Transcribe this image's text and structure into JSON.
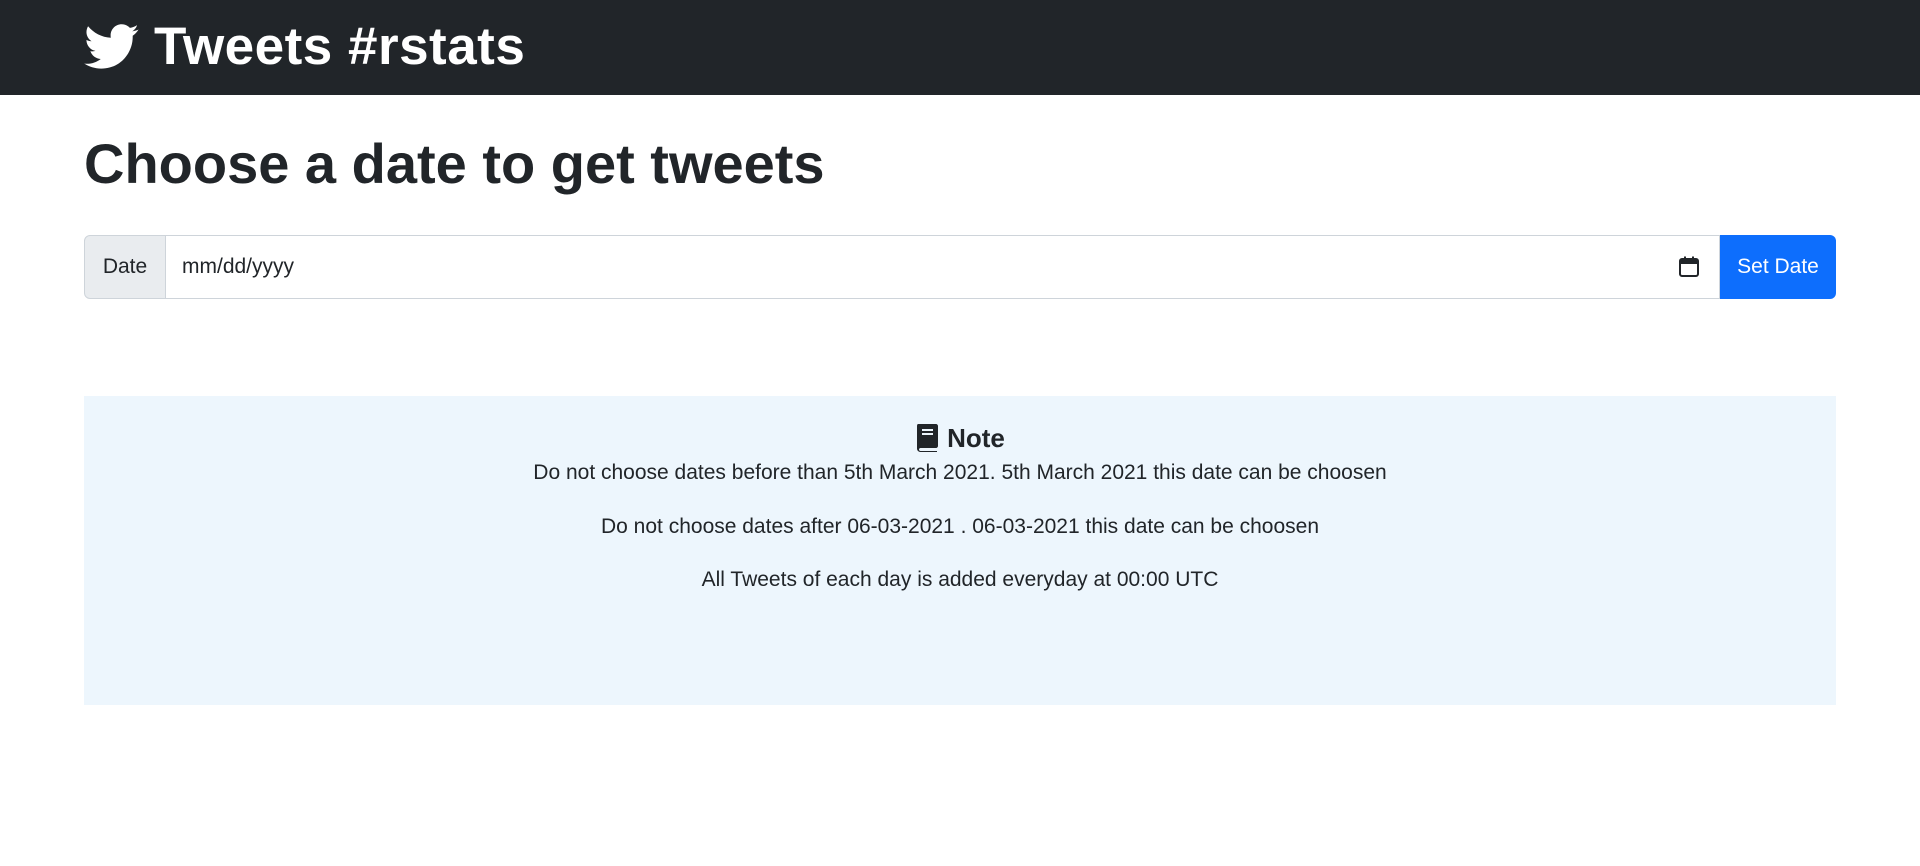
{
  "navbar": {
    "brand_title": "Tweets #rstats",
    "brand_icon": "twitter-bird-icon"
  },
  "page": {
    "title": "Choose a date to get tweets"
  },
  "date_form": {
    "label": "Date",
    "date_input_value": "mm/dd/yyyy",
    "calendar_icon": "calendar-icon",
    "button_label": "Set Date"
  },
  "note": {
    "icon": "book-icon",
    "heading": "Note",
    "lines": [
      "Do not choose dates before than 5th March 2021. 5th March 2021 this date can be choosen",
      "Do not choose dates after 06-03-2021 . 06-03-2021 this date can be choosen",
      "All Tweets of each day is added everyday at 00:00 UTC"
    ]
  },
  "colors": {
    "navbar_bg": "#212529",
    "primary": "#0d6efd",
    "note_bg": "#edf6fd",
    "addon_bg": "#e9ecef",
    "text": "#212529"
  }
}
